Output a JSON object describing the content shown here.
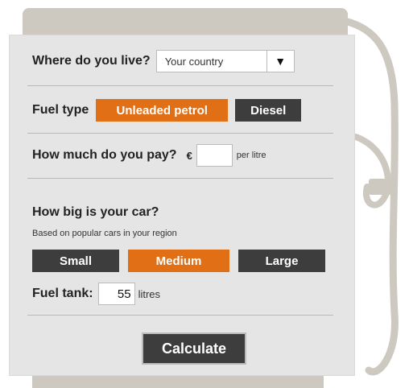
{
  "location": {
    "question": "Where do you live?",
    "selected_value": "Your country",
    "dropdown_icon": "▼"
  },
  "fuel": {
    "label": "Fuel type",
    "options": [
      "Unleaded petrol",
      "Diesel"
    ],
    "selected": "Unleaded petrol"
  },
  "price": {
    "question": "How much do you pay?",
    "currency": "€",
    "value": "",
    "unit": "per litre"
  },
  "car_size": {
    "question": "How big is your car?",
    "subtitle": "Based on popular cars in your region",
    "options": [
      "Small",
      "Medium",
      "Large"
    ],
    "selected": "Medium"
  },
  "tank": {
    "label": "Fuel tank:",
    "value": "55",
    "unit": "litres"
  },
  "calculate_label": "Calculate",
  "colors": {
    "accent": "#e06f16",
    "dark_button": "#3d3d3d",
    "panel": "#e5e5e5",
    "pump": "#cdc9c1"
  }
}
